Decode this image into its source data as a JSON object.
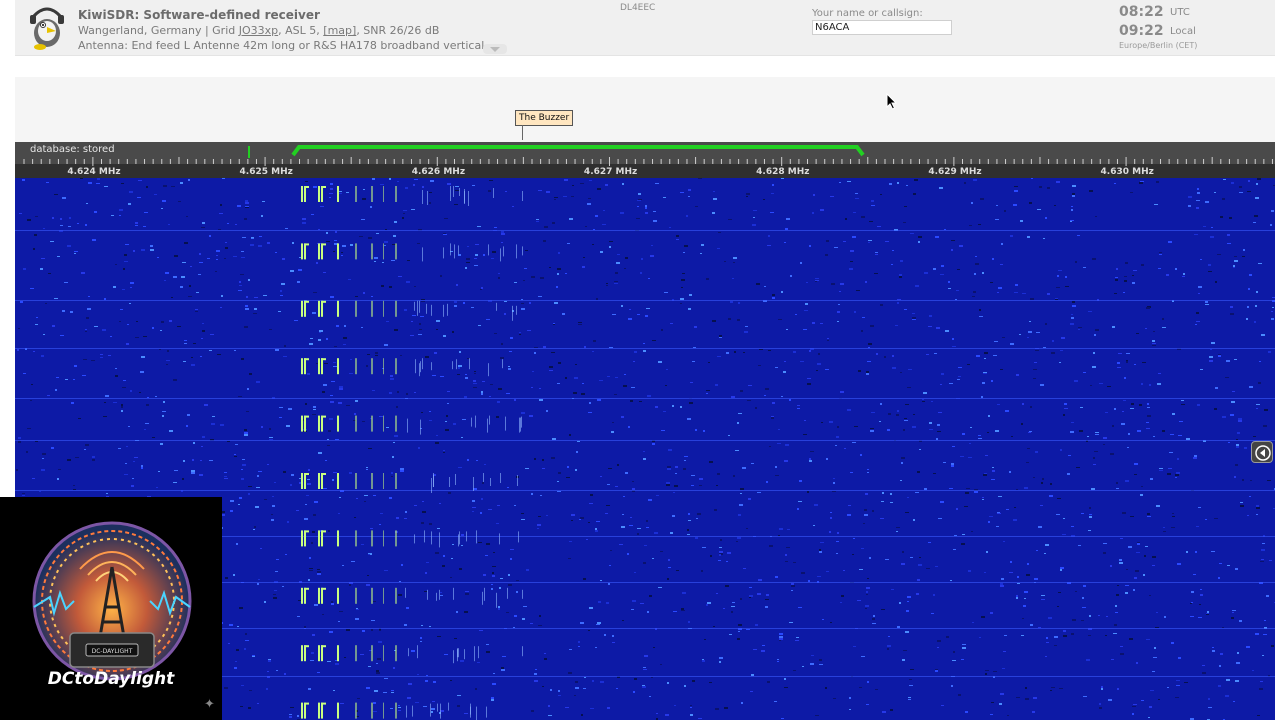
{
  "header": {
    "title": "KiwiSDR: Software-defined receiver",
    "location_prefix": "Wangerland, Germany | Grid ",
    "grid": "JO33xp",
    "asl_text": ", ASL 5, ",
    "map_link": "[map]",
    "snr_text": ", SNR 26/26 dB",
    "antenna": "Antenna: End feed L Antenne 42m long or R&S HA178 broadband vertical",
    "station_id": "DL4EEC"
  },
  "callsign": {
    "label": "Your name or callsign:",
    "value": "N6ACA"
  },
  "clock": {
    "utc_time": "08:22",
    "utc_label": "UTC",
    "local_time": "09:22",
    "local_label": "Local",
    "timezone": "Europe/Berlin (CET)"
  },
  "dx": {
    "label": "The Buzzer"
  },
  "scale": {
    "database_label": "database: stored",
    "freq_labels": [
      "4.624 MHz",
      "4.625 MHz",
      "4.626 MHz",
      "4.627 MHz",
      "4.628 MHz",
      "4.629 MHz",
      "4.630 MHz"
    ],
    "passband_color": "#22d022"
  },
  "waterfall": {
    "background_color": "#0d1aa6",
    "signal_color": "#c8ff80"
  },
  "overlay": {
    "badge_text": "DC-DAYLIGHT",
    "brand_name": "DCtoDaylight"
  },
  "icons": {
    "side_toggle": "arrow-left-circle-icon",
    "cursor": "mouse-pointer-icon",
    "logo": "kiwi-bird-headphones-icon"
  }
}
